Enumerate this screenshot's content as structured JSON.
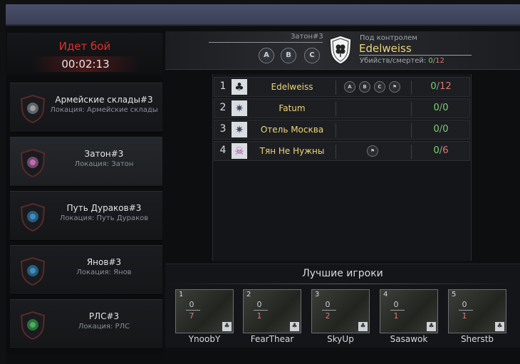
{
  "battle": {
    "title": "Идет бой",
    "timer": "00:02:13"
  },
  "zones": [
    {
      "name": "Армейские склады#3",
      "location": "Локация: Армейские склады",
      "active": false,
      "color": "#9aa0a6"
    },
    {
      "name": "Затон#3",
      "location": "Локация: Затон",
      "active": true,
      "color": "#c06fb0"
    },
    {
      "name": "Путь Дураков#3",
      "location": "Локация: Путь Дураков",
      "active": false,
      "color": "#3c8fc4"
    },
    {
      "name": "Янов#3",
      "location": "Локация: Янов",
      "active": false,
      "color": "#3c8fc4"
    },
    {
      "name": "РЛС#3",
      "location": "Локация: РЛС",
      "active": false,
      "color": "#46b25a"
    }
  ],
  "header": {
    "zone_title": "Затон#3",
    "points": [
      "A",
      "B",
      "C"
    ],
    "control_label": "Под контролем",
    "controller": "Edelweiss",
    "kd_label": "Убийств/смертей:",
    "kd_kills": "0",
    "kd_slash": "/",
    "kd_deaths": "12"
  },
  "clans": [
    {
      "rank": "1",
      "name": "Edelweiss",
      "emblem": "clover-icon",
      "points": [
        "A",
        "B",
        "C"
      ],
      "flag": true,
      "kills": "0",
      "deaths": "12"
    },
    {
      "rank": "2",
      "name": "Fatum",
      "emblem": "star-icon",
      "points": [],
      "flag": false,
      "kills": "0",
      "deaths": "0"
    },
    {
      "rank": "3",
      "name": "Отель Москва",
      "emblem": "star-icon",
      "points": [],
      "flag": false,
      "kills": "0",
      "deaths": "0"
    },
    {
      "rank": "4",
      "name": "Тян Не Нужны",
      "emblem": "skull-icon",
      "points": [],
      "flag": true,
      "kills": "0",
      "deaths": "6"
    }
  ],
  "best": {
    "title": "Лучшие игроки",
    "players": [
      {
        "rank": "1",
        "kills": "0",
        "deaths": "7",
        "name": "YnoobY"
      },
      {
        "rank": "2",
        "kills": "0",
        "deaths": "1",
        "name": "FearThear"
      },
      {
        "rank": "3",
        "kills": "0",
        "deaths": "2",
        "name": "SkyUp"
      },
      {
        "rank": "4",
        "kills": "0",
        "deaths": "1",
        "name": "Sasawok"
      },
      {
        "rank": "5",
        "kills": "0",
        "deaths": "1",
        "name": "Sherstb"
      }
    ]
  },
  "colors": {
    "accent_red": "#e0322c",
    "gold": "#f0d67a",
    "kill_green": "#7bd66a",
    "death_red": "#e0776f"
  }
}
